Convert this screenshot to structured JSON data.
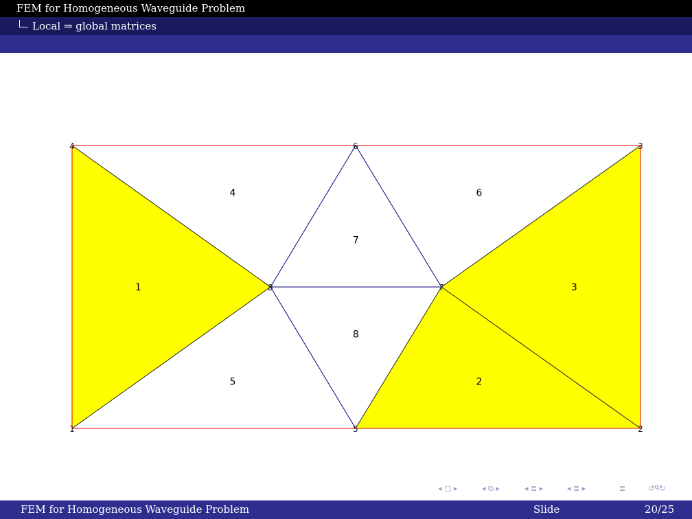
{
  "header": {
    "section": "FEM for Homogeneous Waveguide Problem",
    "subsection": "Local ⇒ global matrices"
  },
  "diagram": {
    "colors": {
      "highlight_fill": "#ffff00",
      "boundary_edge": "#e00000",
      "interior_edge": "#000080",
      "label": "#000000"
    },
    "nodes": [
      {
        "id": "1",
        "label": "1"
      },
      {
        "id": "2",
        "label": "2"
      },
      {
        "id": "3",
        "label": "3"
      },
      {
        "id": "4",
        "label": "4"
      },
      {
        "id": "5",
        "label": "5"
      },
      {
        "id": "6",
        "label": "6"
      },
      {
        "id": "7",
        "label": "7"
      },
      {
        "id": "8",
        "label": "8"
      }
    ],
    "elements": [
      {
        "label": "1",
        "nodes": [
          "1",
          "8",
          "4"
        ],
        "highlighted": true
      },
      {
        "label": "2",
        "nodes": [
          "5",
          "2",
          "7"
        ],
        "highlighted": true
      },
      {
        "label": "3",
        "nodes": [
          "7",
          "2",
          "3"
        ],
        "highlighted": true
      },
      {
        "label": "4",
        "nodes": [
          "4",
          "8",
          "6"
        ],
        "highlighted": false
      },
      {
        "label": "5",
        "nodes": [
          "1",
          "5",
          "8"
        ],
        "highlighted": false
      },
      {
        "label": "6",
        "nodes": [
          "6",
          "7",
          "3"
        ],
        "highlighted": false
      },
      {
        "label": "7",
        "nodes": [
          "8",
          "7",
          "6"
        ],
        "highlighted": false
      },
      {
        "label": "8",
        "nodes": [
          "8",
          "5",
          "7"
        ],
        "highlighted": false
      }
    ]
  },
  "navigation": {
    "icons": [
      "nav-frame-prev-icon",
      "nav-frame-icon",
      "nav-frame-next-icon",
      "nav-subsection-icon",
      "nav-section-icon",
      "nav-align-icon",
      "nav-search-icon"
    ]
  },
  "footer": {
    "title": "FEM for Homogeneous Waveguide Problem",
    "slide_label": "Slide",
    "page": "20/25"
  }
}
